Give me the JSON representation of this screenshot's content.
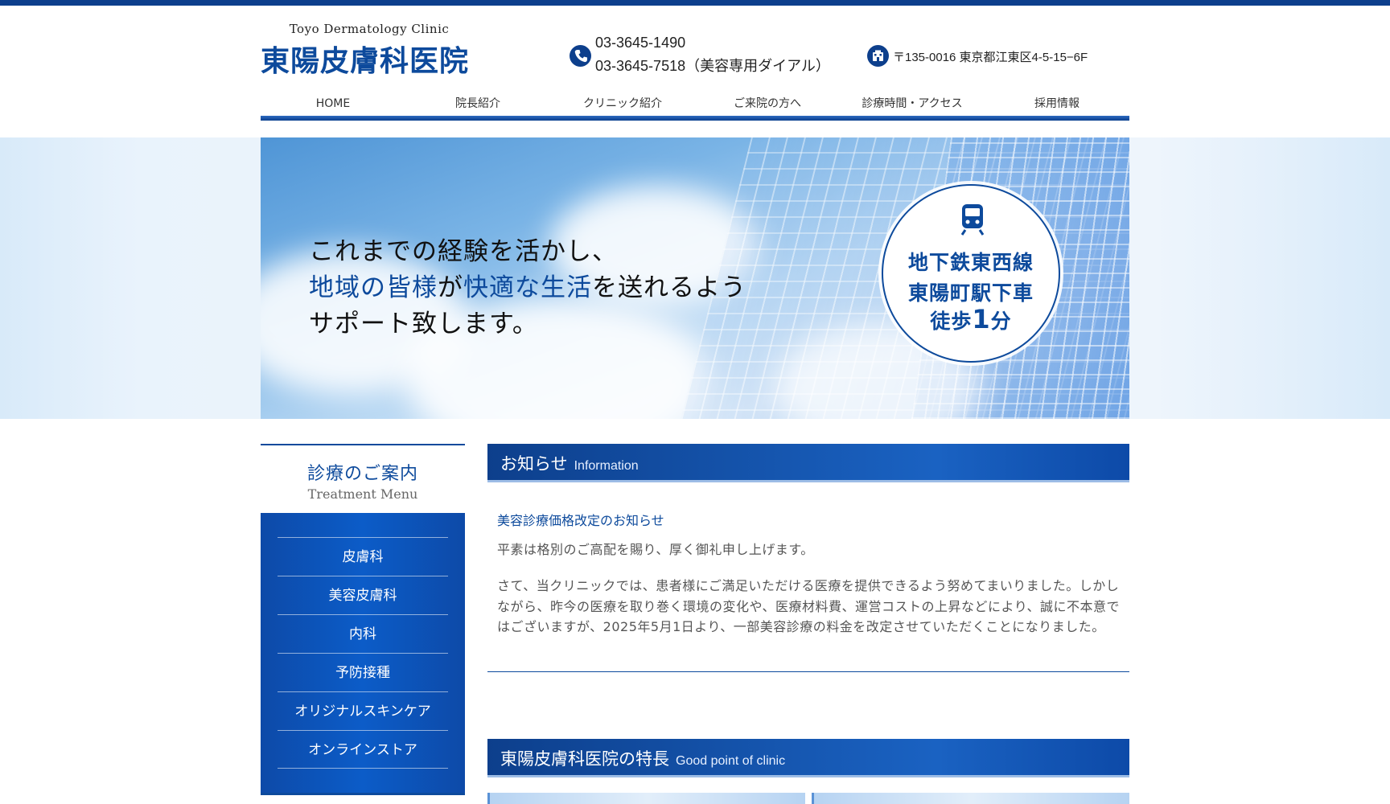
{
  "header": {
    "logo_en": "Toyo Dermatology Clinic",
    "logo_jp": "東陽皮膚科医院",
    "phone_1": "03-3645-1490",
    "phone_2": "03-3645-7518（美容専用ダイアル）",
    "address": "〒135-0016 東京都江東区4-5-15−6F",
    "phone_icon": "phone-icon",
    "address_icon": "building-icon"
  },
  "nav": {
    "items": [
      "HOME",
      "院長紹介",
      "クリニック紹介",
      "ご来院の方へ",
      "診療時間・アクセス",
      "採用情報"
    ]
  },
  "hero": {
    "line1": "これまでの経験を活かし、",
    "line2_a": "地域の皆様",
    "line2_b": "が",
    "line2_c": "快適な生活",
    "line2_d": "を送れるよう",
    "line3": "サポート致します。",
    "badge_icon": "train-icon",
    "badge_line1": "地下鉄東西線",
    "badge_line2": "東陽町駅下車",
    "badge_line3_a": "徒歩",
    "badge_line3_b": "1",
    "badge_line3_c": "分"
  },
  "sidebar": {
    "title": "診療のご案内",
    "subtitle": "Treatment Menu",
    "items": [
      "皮膚科",
      "美容皮膚科",
      "内科",
      "予防接種",
      "オリジナルスキンケア",
      "オンラインストア"
    ]
  },
  "news": {
    "heading_jp": "お知らせ",
    "heading_en": "Information",
    "title": "美容診療価格改定のお知らせ",
    "p1": "平素は格別のご高配を賜り、厚く御礼申し上げます。",
    "p2": "さて、当クリニックでは、患者様にご満足いただける医療を提供できるよう努めてまいりました。しかしながら、昨今の医療を取り巻く環境の変化や、医療材料費、運営コストの上昇などにより、誠に不本意ではございますが、2025年5月1日より、一部美容診療の料金を改定させていただくことになりました。"
  },
  "features": {
    "heading_jp": "東陽皮膚科医院の特長",
    "heading_en": "Good point of clinic"
  },
  "colors": {
    "brand_blue": "#0d4a9c",
    "dark_blue": "#0d3f8c"
  }
}
